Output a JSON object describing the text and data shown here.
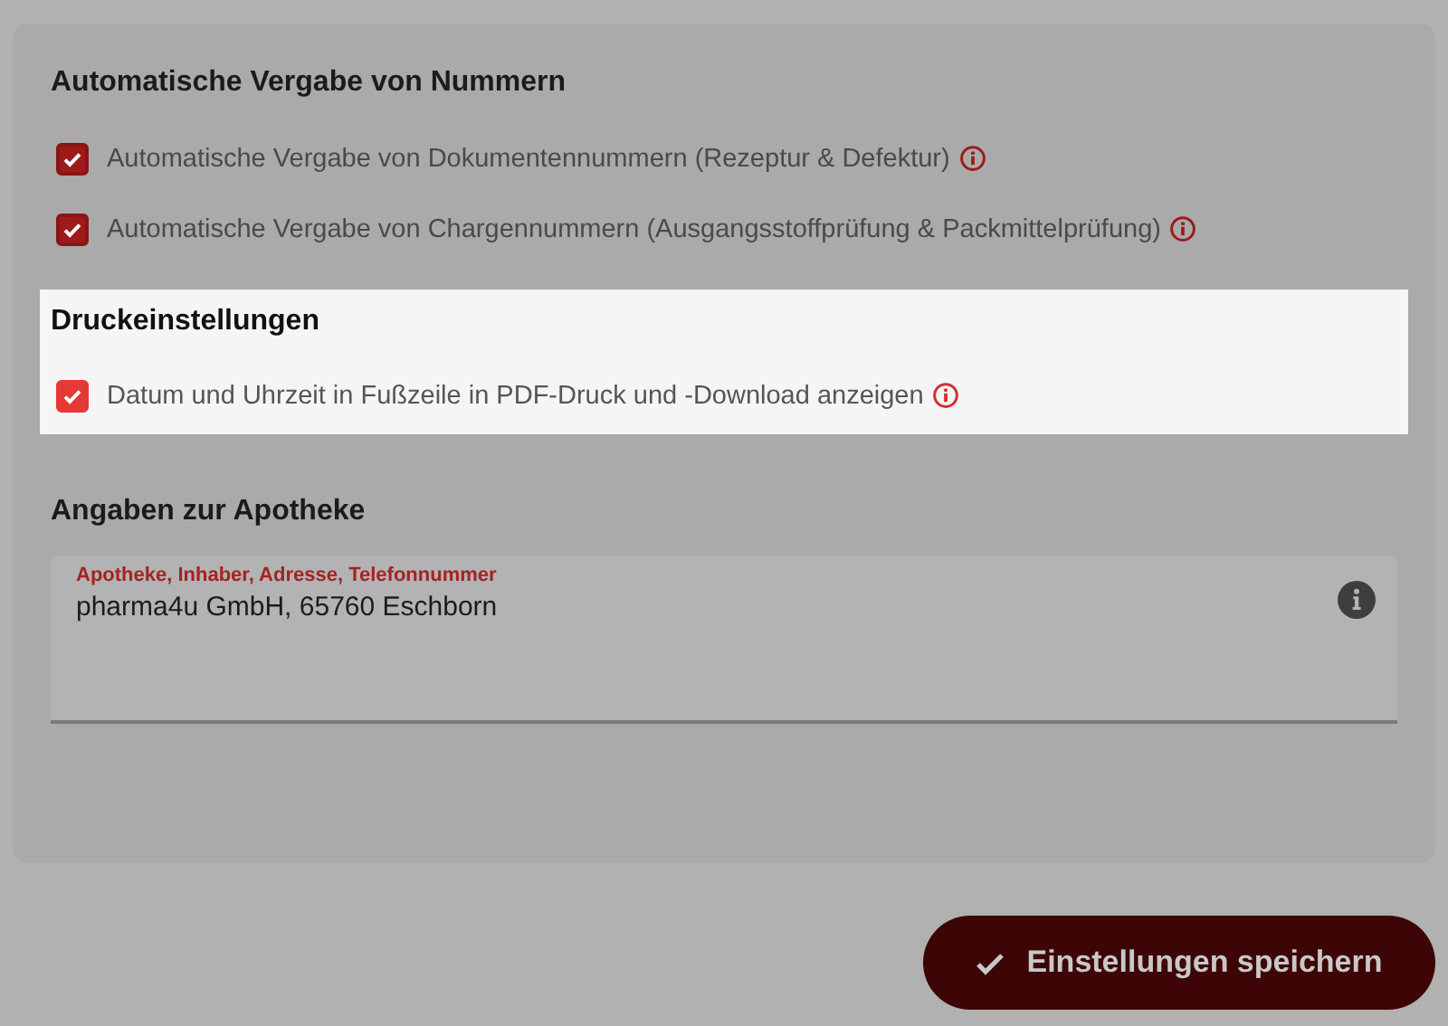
{
  "sections": [
    {
      "title": "Automatische Vergabe von Nummern",
      "highlighted": false,
      "options": [
        {
          "label": "Automatische Vergabe von Dokumentennummern (Rezeptur & Defektur)",
          "checked": true
        },
        {
          "label": "Automatische Vergabe von Chargennummern (Ausgangsstoffprüfung & Packmittelprüfung)",
          "checked": true
        }
      ]
    },
    {
      "title": "Druckeinstellungen",
      "highlighted": true,
      "options": [
        {
          "label": "Datum und Uhrzeit in Fußzeile in PDF-Druck und -Download anzeigen",
          "checked": true
        }
      ]
    },
    {
      "title": "Angaben zur Apotheke",
      "highlighted": false,
      "field": {
        "label": "Apotheke, Inhaber, Adresse, Telefonnummer",
        "value": "pharma4u GmbH, 65760 Eschborn"
      }
    }
  ],
  "save_button": {
    "label": "Einstellungen speichern"
  }
}
